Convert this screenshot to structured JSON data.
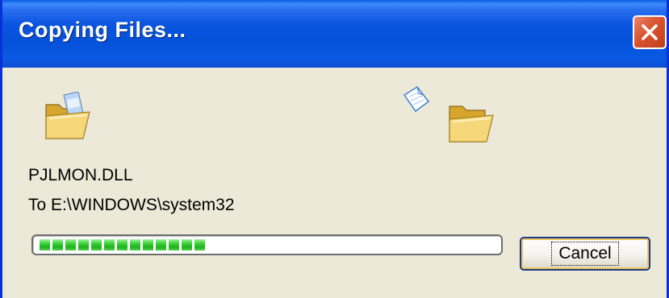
{
  "window": {
    "title": "Copying Files...",
    "close_icon": "close-icon"
  },
  "file": {
    "name": "PJLMON.DLL",
    "destination": "To E:\\WINDOWS\\system32"
  },
  "progress": {
    "fraction": 0.37
  },
  "buttons": {
    "cancel_label": "Cancel"
  },
  "icons": {
    "source": "open-folder-icon",
    "flying": "flying-document-icon",
    "destination": "folder-icon"
  },
  "colors": {
    "titlebar": "#0451d8",
    "dialog_background": "#ece9d8",
    "progress_fill": "#2fbf2c",
    "close_button": "#d9542f"
  }
}
